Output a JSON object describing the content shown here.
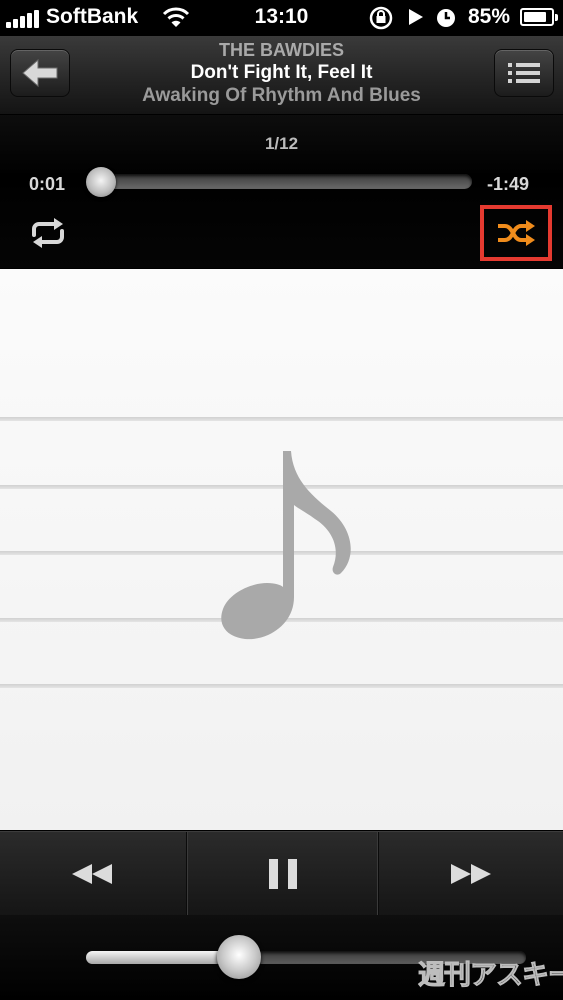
{
  "status_bar": {
    "carrier": "SoftBank",
    "time": "13:10",
    "battery_percent": "85%",
    "battery_level": 0.85,
    "icons": [
      "signal-bars-icon",
      "wifi-icon",
      "rotation-lock-icon",
      "play-indicator-icon",
      "alarm-icon",
      "battery-icon"
    ]
  },
  "header": {
    "artist": "THE BAWDIES",
    "song": "Don't Fight It, Feel It",
    "album": "Awaking Of Rhythm And Blues",
    "back_icon": "back-arrow-icon",
    "list_icon": "track-list-icon"
  },
  "playback": {
    "track_counter": "1/12",
    "elapsed": "0:01",
    "remaining": "-1:49",
    "progress": 0.01,
    "repeat_icon": "repeat-icon",
    "shuffle_icon": "shuffle-icon",
    "shuffle_highlight_color": "#e53a30",
    "shuffle_color": "#f08c1c"
  },
  "artwork": {
    "placeholder_icon": "music-note-icon"
  },
  "transport": {
    "prev_icon": "rewind-icon",
    "pause_icon": "pause-icon",
    "next_icon": "fast-forward-icon"
  },
  "volume": {
    "level": 0.35
  },
  "watermark": {
    "text": "週刊アスキー"
  }
}
